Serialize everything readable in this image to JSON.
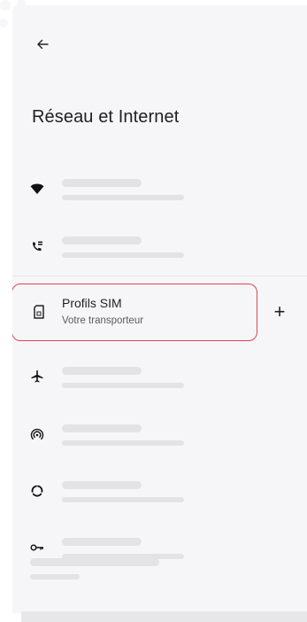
{
  "header": {
    "title": "Réseau et Internet",
    "back_icon": "arrow-back-icon"
  },
  "rows": [
    {
      "icon": "wifi-icon"
    },
    {
      "icon": "phone-wifi-icon"
    },
    {
      "icon": "sim-card-icon",
      "title": "Profils SIM",
      "subtitle": "Votre transporteur"
    },
    {
      "icon": "airplane-icon"
    },
    {
      "icon": "hotspot-icon"
    },
    {
      "icon": "data-saver-icon"
    },
    {
      "icon": "vpn-key-icon"
    }
  ],
  "sim": {
    "title": "Profils SIM",
    "subtitle": "Votre transporteur",
    "highlight_color": "#e0435a"
  },
  "actions": {
    "add_label": "+"
  }
}
